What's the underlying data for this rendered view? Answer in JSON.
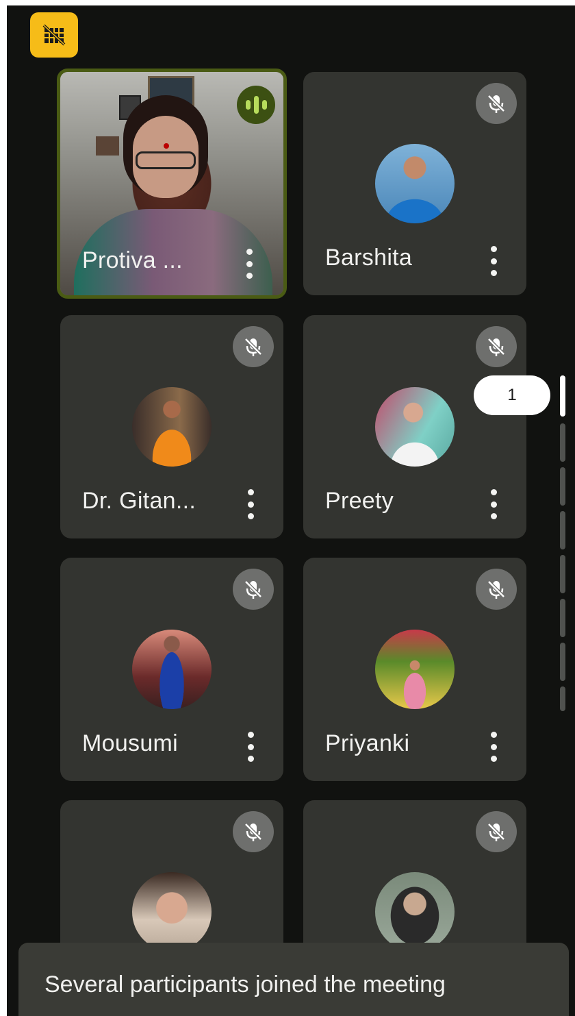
{
  "badge": {
    "icon": "camera-off-grid-icon",
    "color": "#f6bc18"
  },
  "participants": [
    {
      "name": "Protiva ...",
      "speaking": true,
      "video": true
    },
    {
      "name": "Barshita",
      "muted": true,
      "avatar_colors": [
        "#1a73c8",
        "#e2b44b",
        "#7fb2d8"
      ]
    },
    {
      "name": "Dr. Gitan...",
      "muted": true,
      "avatar_colors": [
        "#f08a1a",
        "#3a2e2a",
        "#8a6a4a"
      ]
    },
    {
      "name": "Preety",
      "muted": true,
      "avatar_colors": [
        "#f3f3f3",
        "#7fd0c6",
        "#c24a6a"
      ]
    },
    {
      "name": "Mousumi",
      "muted": true,
      "avatar_colors": [
        "#1b3fa8",
        "#d88a7a",
        "#3a2020"
      ]
    },
    {
      "name": "Priyanki",
      "muted": true,
      "avatar_colors": [
        "#e88aa8",
        "#5a8a2a",
        "#c83a4a"
      ]
    },
    {
      "name": "",
      "muted": true,
      "avatar_colors": [
        "#d8c8b8",
        "#3a2a22",
        "#b8a898"
      ]
    },
    {
      "name": "",
      "muted": true,
      "avatar_colors": [
        "#2a2a2a",
        "#7a8a7a",
        "#c8a890"
      ]
    }
  ],
  "pager": {
    "current_page": "1"
  },
  "toast": {
    "message": "Several participants joined the meeting"
  }
}
